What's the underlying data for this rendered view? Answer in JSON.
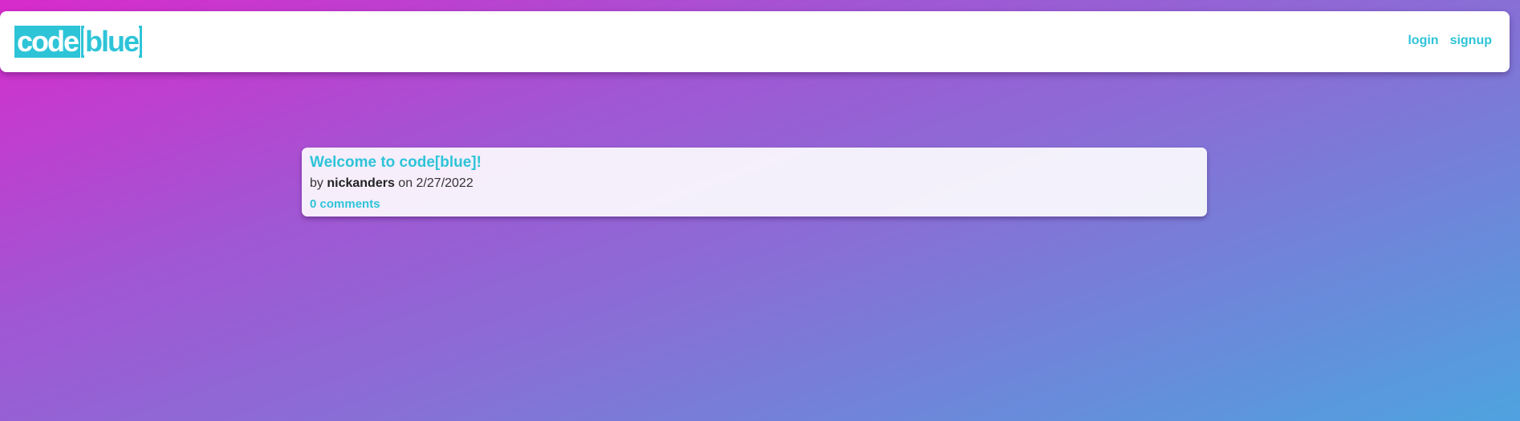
{
  "header": {
    "logo": {
      "code": "code",
      "blue": "blue"
    },
    "nav": {
      "login": "login",
      "signup": "signup"
    }
  },
  "posts": [
    {
      "title": "Welcome to code[blue]!",
      "by_label": "by",
      "author": "nickanders",
      "on_label": "on",
      "date": "2/27/2022",
      "comments": "0 comments"
    }
  ],
  "colors": {
    "accent": "#2ec4d8",
    "gradient_start": "#d82bcc",
    "gradient_end": "#4ea3df"
  }
}
